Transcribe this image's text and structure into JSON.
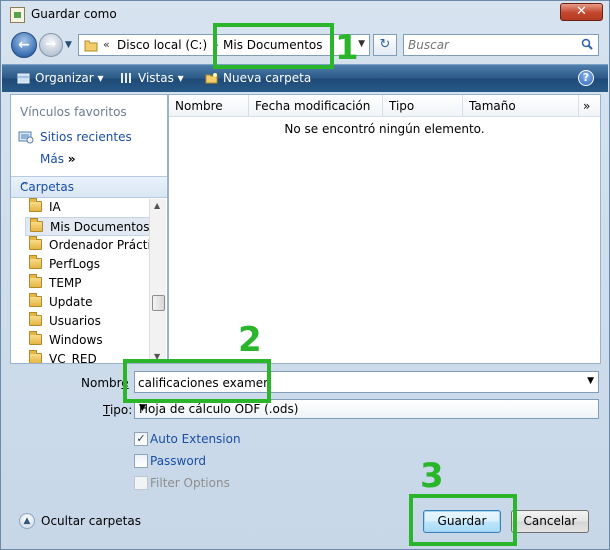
{
  "window": {
    "title": "Guardar como",
    "close_glyph": "✕"
  },
  "nav": {
    "back_glyph": "←",
    "forward_glyph": "→",
    "address": {
      "overflow_chevron": "«",
      "crumb_1": "Disco local (C:)",
      "arrow": "▸",
      "crumb_2": "Mis Documentos"
    },
    "refresh_glyph": "↻",
    "search_placeholder": "Buscar"
  },
  "toolbar": {
    "organize": "Organizar",
    "views": "Vistas",
    "new_folder": "Nueva carpeta",
    "help": "?"
  },
  "left_pane": {
    "favorites_header": "Vínculos favoritos",
    "recent_places": "Sitios recientes",
    "more": "Más",
    "more_glyph": "»",
    "folders_header": "Carpetas",
    "folders": [
      "IA",
      "Mis Documentos",
      "Ordenador Práctico",
      "PerfLogs",
      "TEMP",
      "Update",
      "Usuarios",
      "Windows",
      "VC_RED"
    ],
    "selected_folder": "Mis Documentos"
  },
  "file_list": {
    "columns": [
      "Nombre",
      "Fecha modificación",
      "Tipo",
      "Tamaño"
    ],
    "more_columns": "»",
    "empty_message": "No se encontró ningún elemento."
  },
  "form": {
    "name_label_main": "Nombr",
    "name_label_tail": "e",
    "name_value": "calificaciones examen",
    "type_label_u": "T",
    "type_label_rest": "ipo:",
    "type_value": "Hoja de cálculo ODF (.ods)",
    "auto_extension": "Auto Extension",
    "auto_extension_checked": true,
    "password": "Password",
    "password_checked": false,
    "filter_options": "Filter Options",
    "filter_options_checked": false
  },
  "footer": {
    "hide_folders": "Ocultar carpetas",
    "save": "Guardar",
    "cancel": "Cancelar"
  },
  "annotations": {
    "step1": "1",
    "step2": "2",
    "step3": "3",
    "color": "#2bb52b"
  }
}
